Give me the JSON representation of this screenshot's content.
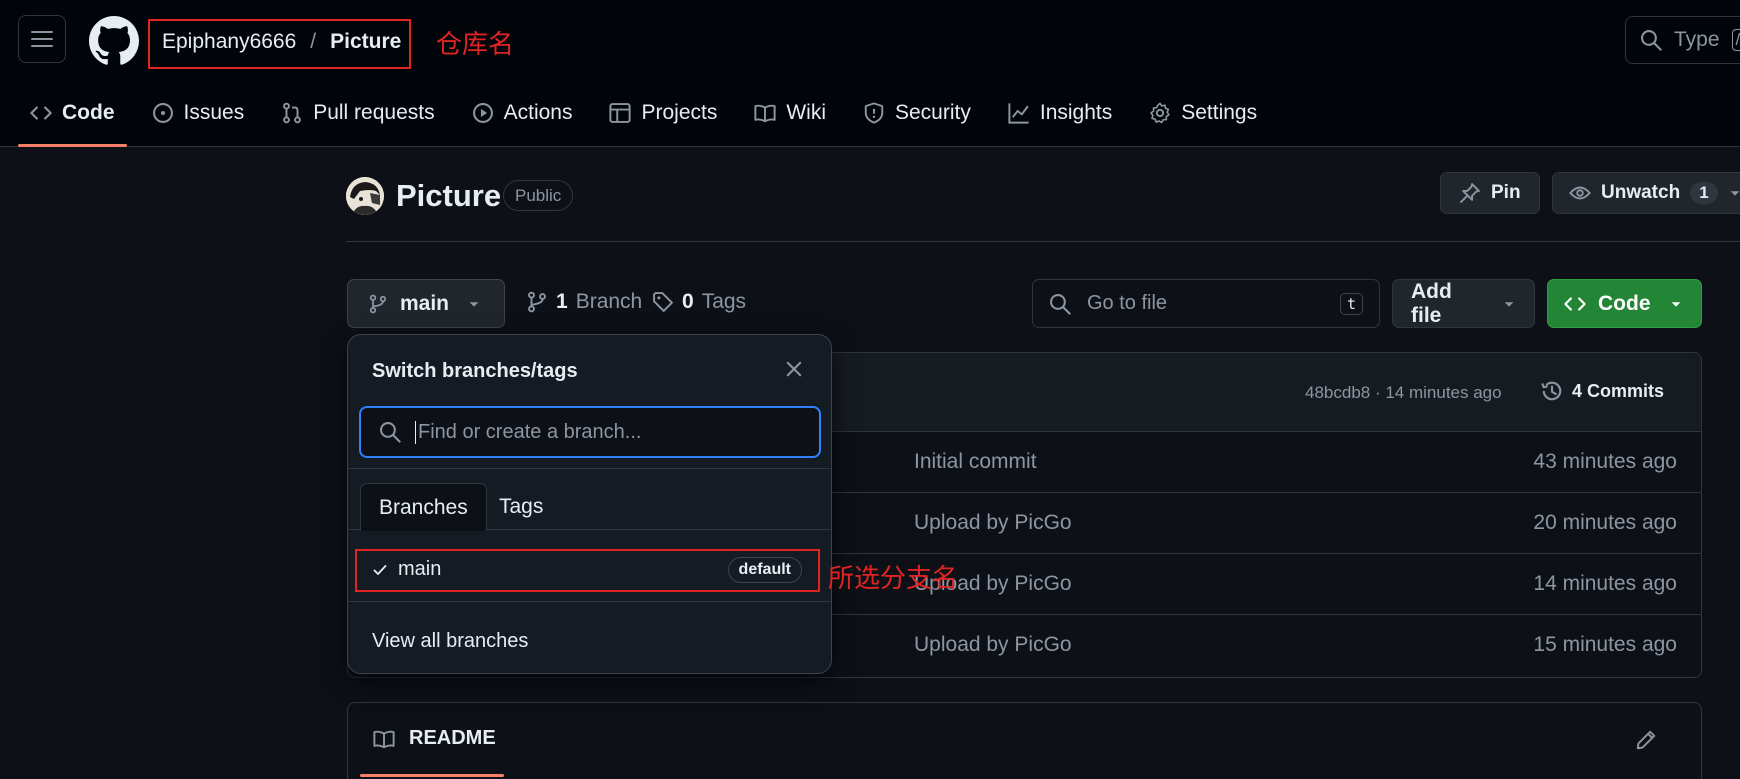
{
  "header": {
    "owner": "Epiphany6666",
    "separator": "/",
    "repo": "Picture",
    "annotation_repo": "仓库名",
    "search_placeholder": "Type",
    "search_kbd": "/"
  },
  "tabs": [
    {
      "label": "Code",
      "icon": "code-icon"
    },
    {
      "label": "Issues",
      "icon": "issue-icon"
    },
    {
      "label": "Pull requests",
      "icon": "pull-request-icon"
    },
    {
      "label": "Actions",
      "icon": "play-icon"
    },
    {
      "label": "Projects",
      "icon": "table-icon"
    },
    {
      "label": "Wiki",
      "icon": "book-icon"
    },
    {
      "label": "Security",
      "icon": "shield-icon"
    },
    {
      "label": "Insights",
      "icon": "graph-icon"
    },
    {
      "label": "Settings",
      "icon": "gear-icon"
    }
  ],
  "repo_header": {
    "title": "Picture",
    "visibility": "Public",
    "pin_label": "Pin",
    "watch_label": "Unwatch",
    "watch_count": "1"
  },
  "branch_bar": {
    "current_branch": "main",
    "branch_count": "1",
    "branch_label": "Branch",
    "tag_count": "0",
    "tag_label": "Tags",
    "go_to_file_placeholder": "Go to file",
    "go_to_file_kbd": "t",
    "add_file_label": "Add file",
    "code_label": "Code"
  },
  "latest_commit": {
    "meta": "48bcdb8 · 14 minutes ago",
    "commits_label": "4 Commits"
  },
  "files": [
    {
      "message": "Initial commit",
      "time": "43 minutes ago"
    },
    {
      "message": "Upload by PicGo",
      "time": "20 minutes ago"
    },
    {
      "message": "Upload by PicGo",
      "time": "14 minutes ago"
    },
    {
      "message": "Upload by PicGo",
      "time": "15 minutes ago"
    }
  ],
  "readme": {
    "label": "README"
  },
  "dropdown": {
    "title": "Switch branches/tags",
    "search_placeholder": "Find or create a branch...",
    "tab_branches": "Branches",
    "tab_tags": "Tags",
    "item_name": "main",
    "item_badge": "default",
    "view_all": "View all branches",
    "annotation_branch": "所选分支名"
  },
  "colors": {
    "background": "#0d1117",
    "header_bg": "#010409",
    "accent_underline": "#f78166",
    "code_button": "#238636",
    "focus_blue": "#2f81f7",
    "annotation_red": "#e02424"
  }
}
